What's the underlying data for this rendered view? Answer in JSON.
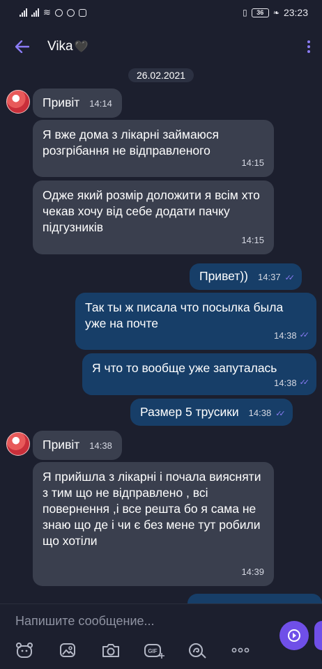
{
  "status": {
    "battery": "36",
    "time": "23:23"
  },
  "header": {
    "back_icon": "arrow-left-icon",
    "name": "Vika",
    "heart": "🖤",
    "menu_icon": "more-vertical-icon"
  },
  "date": "26.02.2021",
  "messages": [
    {
      "dir": "in",
      "text": "Привіт",
      "time": "14:14"
    },
    {
      "dir": "in",
      "text": "Я вже дома з лікарні займаюся розгрібання не відправленого",
      "time": "14:15"
    },
    {
      "dir": "in",
      "text": "Одже який розмір доложити я всім хто чекав хочу від себе додати пачку підгузників",
      "time": "14:15"
    },
    {
      "dir": "out",
      "text": "Привет))",
      "time": "14:37"
    },
    {
      "dir": "out",
      "text": "Так ты ж писала что посылка была уже на почте",
      "time": "14:38"
    },
    {
      "dir": "out",
      "text": "Я что то вообще уже запуталась",
      "time": "14:38"
    },
    {
      "dir": "out",
      "text": "Размер 5 трусики",
      "time": "14:38"
    },
    {
      "dir": "in",
      "text": "Привіт",
      "time": "14:38"
    },
    {
      "dir": "in",
      "text": "Я прийшла з лікарні і почала виясняти з тим що не відправлено , всі повернення ,і все решта бо я сама не знаю що де і чи є без мене тут робили що хотіли",
      "time": "14:39"
    }
  ],
  "composer": {
    "placeholder": "Напишите сообщение...",
    "tools": [
      "sticker-icon",
      "gallery-icon",
      "camera-icon",
      "gif-icon",
      "doodle-icon",
      "more-horizontal-icon"
    ],
    "send_icon": "send-icon"
  },
  "colors": {
    "background": "#1c1f2e",
    "incoming": "#3a3f4e",
    "outgoing": "#173e68",
    "accent": "#8b7cf6"
  }
}
